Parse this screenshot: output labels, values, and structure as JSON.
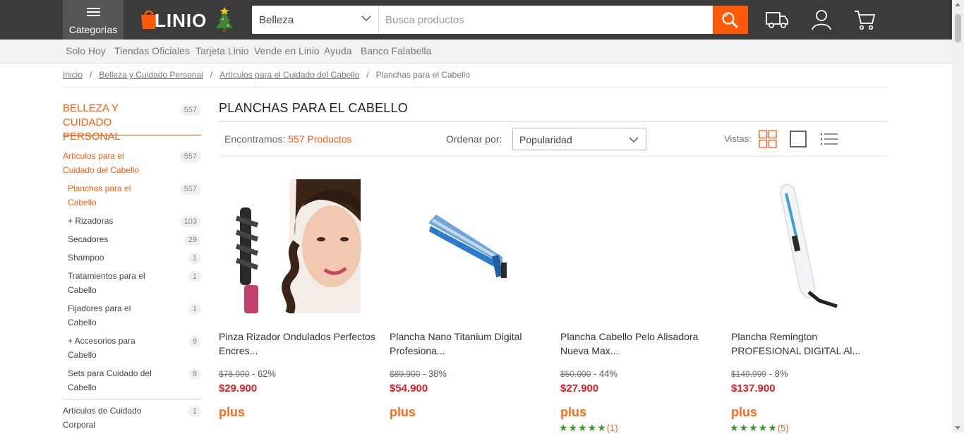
{
  "header": {
    "categories_label": "Categorías",
    "logo_text": "LINIO",
    "search": {
      "category": "Belleza",
      "placeholder": "Busca productos"
    }
  },
  "subnav": [
    "Solo Hoy",
    "Tiendas Oficiales",
    "Tarjeta Linio",
    "Vende en Linio",
    "Ayuda",
    "Banco Falabella"
  ],
  "breadcrumb": [
    "Inicio",
    "Belleza y Cuidado Personal",
    "Artículos para el Cuidado del Cabello",
    "Planchas para el Cabello"
  ],
  "sidebar": {
    "head": {
      "label": "BELLEZA Y CUIDADO PERSONAL",
      "count": "557"
    },
    "items": [
      {
        "label": "Artículos para el Cuidado del Cabello",
        "count": "557"
      },
      {
        "label": "Planchas para el Cabello",
        "count": "557"
      },
      {
        "label": "+ Rizadoras",
        "count": "103"
      },
      {
        "label": "Secadores",
        "count": "29"
      },
      {
        "label": "Shampoo",
        "count": "1"
      },
      {
        "label": "Tratamientos para el Cabello",
        "count": "1"
      },
      {
        "label": "Fijadores para el Cabello",
        "count": "1"
      },
      {
        "label": "+ Accesorios para Cabello",
        "count": "9"
      },
      {
        "label": "Sets para Cuidado del Cabello",
        "count": "9"
      },
      {
        "label": "Artículos de Cuidado Corporal",
        "count": "1"
      }
    ]
  },
  "main": {
    "title": "PLANCHAS PARA EL CABELLO",
    "found_prefix": "Encontramos:",
    "found_count": "557 Productos",
    "order_label": "Ordenar por:",
    "order_value": "Popularidad",
    "views_label": "Vistas:"
  },
  "products": [
    {
      "name": "Pinza Rizador Ondulados Perfectos Encres...",
      "old_price": "$78.900",
      "discount": " - 62%",
      "price": "$29.900",
      "plus": "plus",
      "stars": "",
      "reviews": ""
    },
    {
      "name": "Plancha Nano Titanium Digital Profesiona...",
      "old_price": "$89.900",
      "discount": " - 38%",
      "price": "$54.900",
      "plus": "plus",
      "stars": "",
      "reviews": ""
    },
    {
      "name": "Plancha Cabello Pelo Alisadora Nueva Max...",
      "old_price": "$50.000",
      "discount": " - 44%",
      "price": "$27.900",
      "plus": "plus",
      "stars": "★★★★★",
      "reviews": "(1)"
    },
    {
      "name": "Plancha Remington PROFESIONAL DIGITAL Al...",
      "old_price": "$149.999",
      "discount": " - 8%",
      "price": "$137.900",
      "plus": "plus",
      "stars": "★★★★★",
      "reviews": "(5)"
    }
  ],
  "colors": {
    "accent": "#ff5a0a",
    "price": "#e31c25",
    "header_bg": "#3b3b3b",
    "rating": "#3c9a2f"
  }
}
